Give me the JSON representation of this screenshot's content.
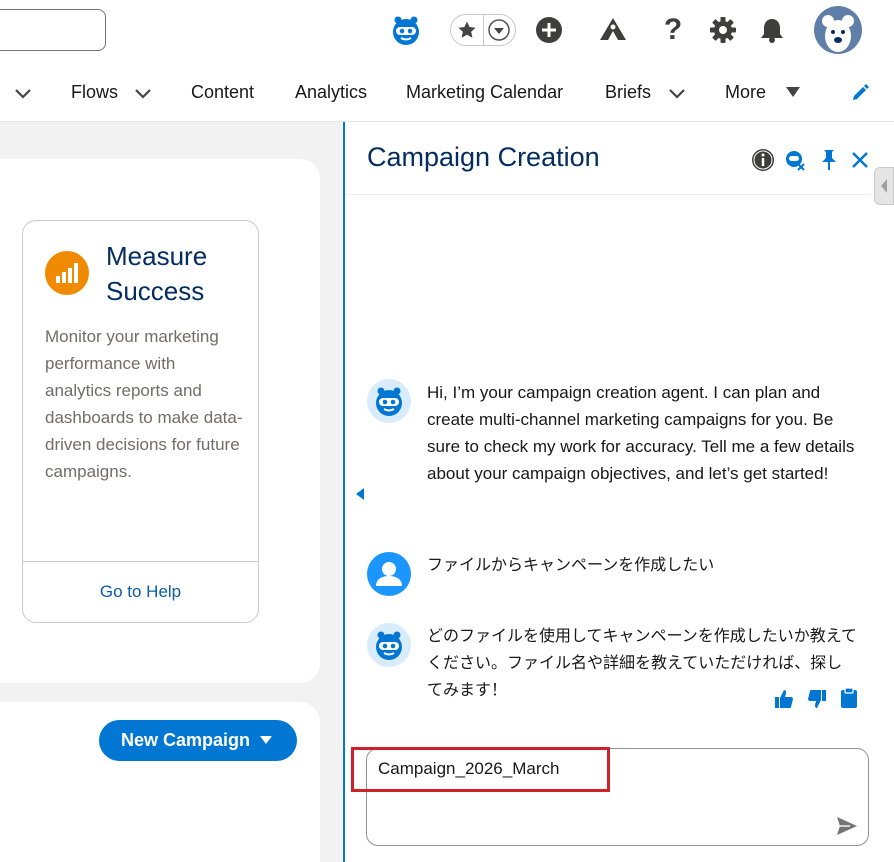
{
  "header": {
    "search_value": "",
    "icons": [
      "agent-icon",
      "star-icon",
      "chevron-down-icon",
      "add-icon",
      "trailhead-icon",
      "help-icon",
      "settings-icon",
      "bell-icon",
      "avatar"
    ]
  },
  "nav": {
    "items": [
      {
        "label": "Flows"
      },
      {
        "label": "Content"
      },
      {
        "label": "Analytics"
      },
      {
        "label": "Marketing Calendar"
      },
      {
        "label": "Briefs"
      },
      {
        "label": "More"
      }
    ]
  },
  "measure_card": {
    "title": "Measure Success",
    "description": "Monitor your marketing performance with analytics reports and dashboards to make data-driven decisions for future campaigns.",
    "link": "Go to Help"
  },
  "new_campaign": {
    "label": "New Campaign"
  },
  "panel": {
    "title": "Campaign Creation",
    "messages": [
      {
        "role": "agent",
        "text": "Hi, I’m your campaign creation agent. I can plan and create multi-channel marketing campaigns for you. Be sure to check my work for accuracy. Tell me a few details about your campaign objectives, and let’s get started!"
      },
      {
        "role": "user",
        "text": "ファイルからキャンペーンを作成したい"
      },
      {
        "role": "agent",
        "text": "どのファイルを使用してキャンペーンを作成したいか教えてください。ファイル名や詳細を教えていただければ、探してみます！"
      }
    ],
    "input_value": "Campaign_2026_March"
  },
  "colors": {
    "brand": "#0176d3",
    "title_navy": "#032d60",
    "measure_orange": "#f08a00",
    "highlight_red": "#d0202a"
  }
}
